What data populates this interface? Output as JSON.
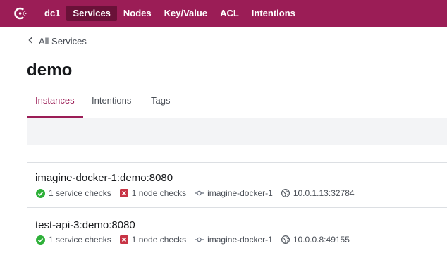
{
  "nav": {
    "datacenter": "dc1",
    "items": [
      {
        "label": "Services",
        "active": true
      },
      {
        "label": "Nodes",
        "active": false
      },
      {
        "label": "Key/Value",
        "active": false
      },
      {
        "label": "ACL",
        "active": false
      },
      {
        "label": "Intentions",
        "active": false
      }
    ]
  },
  "breadcrumb": {
    "label": "All Services"
  },
  "page": {
    "title": "demo"
  },
  "tabs": [
    {
      "label": "Instances",
      "active": true
    },
    {
      "label": "Intentions",
      "active": false
    },
    {
      "label": "Tags",
      "active": false
    }
  ],
  "instances": [
    {
      "name": "imagine-docker-1:demo:8080",
      "service_checks": "1 service checks",
      "node_checks": "1 node checks",
      "node": "imagine-docker-1",
      "address": "10.0.1.13:32784"
    },
    {
      "name": "test-api-3:demo:8080",
      "service_checks": "1 service checks",
      "node_checks": "1 node checks",
      "node": "imagine-docker-1",
      "address": "10.0.0.8:49155"
    }
  ],
  "colors": {
    "brand": "#9b1d56",
    "brand_active": "#6a1138",
    "passing": "#2eb039",
    "critical": "#c73445"
  }
}
